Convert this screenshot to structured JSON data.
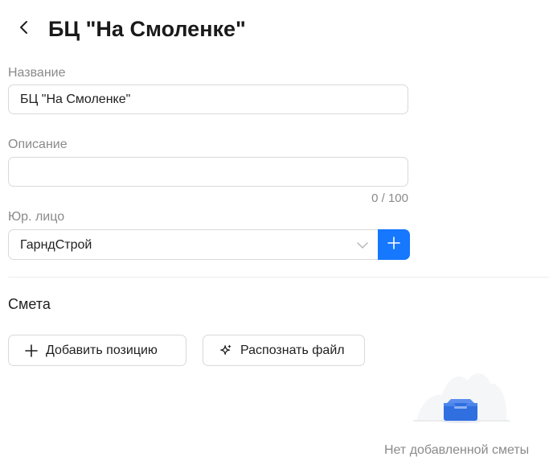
{
  "header": {
    "back_icon": "chevron-left-icon",
    "title": "БЦ \"На Смоленке\""
  },
  "form": {
    "name": {
      "label": "Название",
      "value": "БЦ \"На Смоленке\""
    },
    "description": {
      "label": "Описание",
      "value": "",
      "counter": "0 / 100"
    },
    "legal_entity": {
      "label": "Юр. лицо",
      "value": "ГарндСтрой",
      "dropdown_icon": "chevron-down-icon",
      "add_icon": "plus-icon"
    }
  },
  "estimate": {
    "title": "Смета",
    "add_position_label": "Добавить позицию",
    "add_position_icon": "plus-icon",
    "recognize_file_label": "Распознать файл",
    "recognize_file_icon": "sparkle-icon",
    "empty_text": "Нет добавленной сметы",
    "empty_icon": "empty-box-icon"
  },
  "colors": {
    "accent": "#1677ff",
    "border": "#d9d9d9",
    "muted_text": "#8a8a8a"
  }
}
